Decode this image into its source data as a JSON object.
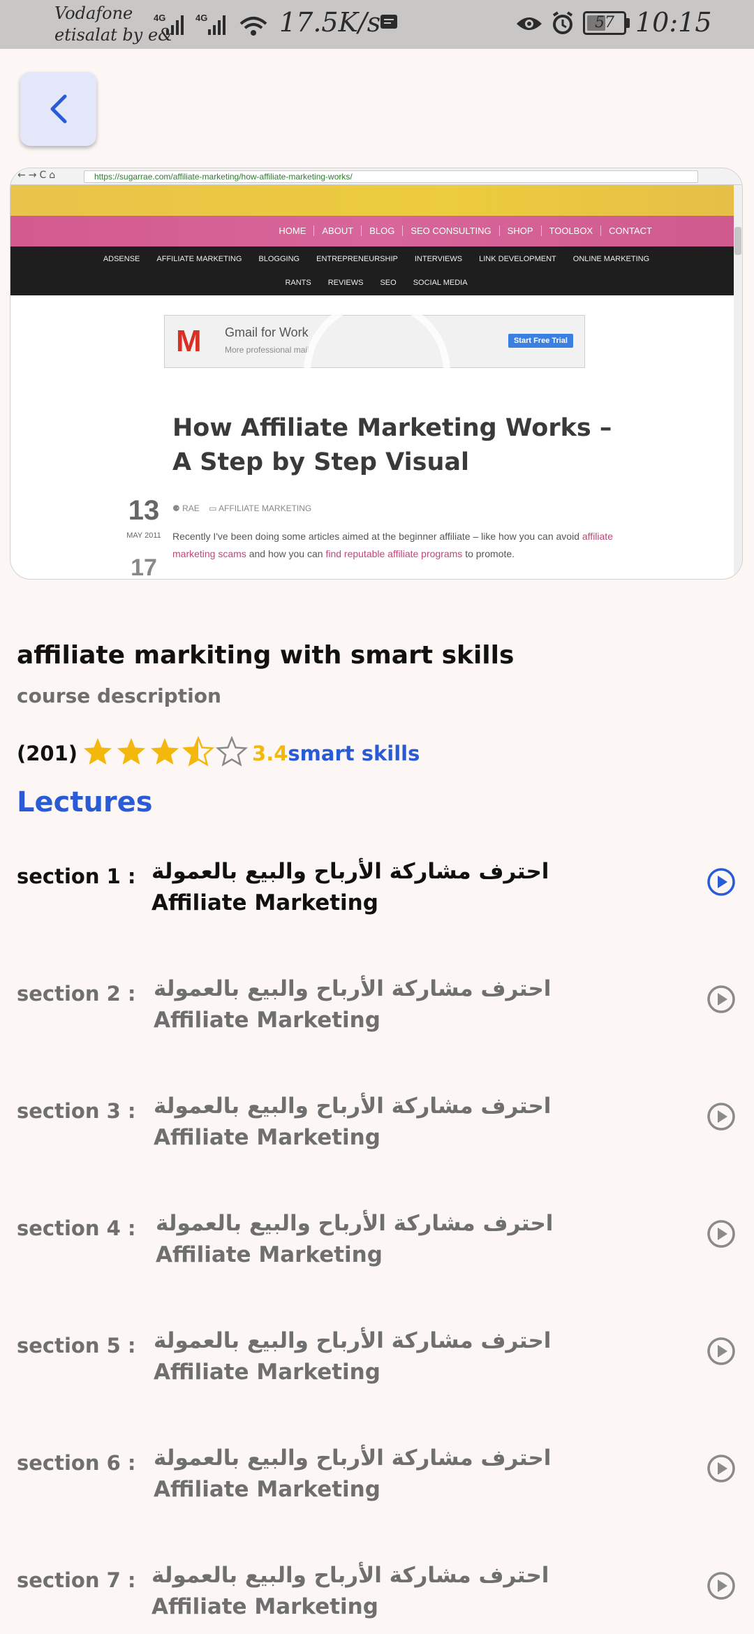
{
  "status_bar": {
    "carrier_line1": "Vodafone",
    "carrier_line2": "etisalat by e&",
    "net1": "4G",
    "net2": "4G",
    "speed": "17.5K/s",
    "battery": "57",
    "battery_level": 57,
    "time": "10:15"
  },
  "video": {
    "url": "https://sugarrae.com/affiliate-marketing/how-affiliate-marketing-works/",
    "top_menu": [
      "HOME",
      "ABOUT",
      "BLOG",
      "SEO CONSULTING",
      "SHOP",
      "TOOLBOX",
      "CONTACT"
    ],
    "categories_row1": [
      "ADSENSE",
      "AFFILIATE MARKETING",
      "BLOGGING",
      "ENTREPRENEURSHIP",
      "INTERVIEWS",
      "LINK DEVELOPMENT",
      "ONLINE MARKETING"
    ],
    "categories_row2": [
      "RANTS",
      "REVIEWS",
      "SEO",
      "SOCIAL MEDIA"
    ],
    "ad_title": "Gmail for Work",
    "ad_sub": "More professional   mail",
    "ad_button": "Start Free Trial",
    "article_title": "How Affiliate Marketing Works – A Step by Step Visual",
    "date_day": "13",
    "date_month": "MAY 2011",
    "date_next": "17",
    "meta_author": "RAE",
    "meta_category": "AFFILIATE MARKETING",
    "excerpt_1": "Recently I've been doing some articles aimed at the beginner affiliate – like how you can avoid ",
    "excerpt_link1": "affiliate marketing scams",
    "excerpt_2": " and how you can ",
    "excerpt_link2": "find reputable affiliate programs",
    "excerpt_3": " to promote."
  },
  "course": {
    "title": "affiliate markiting with smart skills",
    "description_label": "course description",
    "rating_count": "(201)",
    "rating": 3.4,
    "rating_text": "3.4",
    "author": "smart skills",
    "lectures_heading": "Lectures"
  },
  "lectures": [
    {
      "section": "section 1 :",
      "title": "احترف مشاركة الأرباح والبيع بالعمولة Affiliate Marketing",
      "active": true
    },
    {
      "section": "section 2 :",
      "title": "احترف مشاركة الأرباح والبيع بالعمولة Affiliate Marketing",
      "active": false
    },
    {
      "section": "section 3 :",
      "title": "احترف مشاركة الأرباح والبيع بالعمولة Affiliate Marketing",
      "active": false
    },
    {
      "section": "section 4 :",
      "title": "احترف مشاركة الأرباح والبيع بالعمولة Affiliate Marketing",
      "active": false
    },
    {
      "section": "section 5 :",
      "title": "احترف مشاركة الأرباح والبيع بالعمولة Affiliate Marketing",
      "active": false
    },
    {
      "section": "section 6 :",
      "title": "احترف مشاركة الأرباح والبيع بالعمولة Affiliate Marketing",
      "active": false
    },
    {
      "section": "section 7 :",
      "title": "احترف مشاركة الأرباح والبيع بالعمولة Affiliate Marketing",
      "active": false
    }
  ],
  "colors": {
    "accent": "#2a5bd7",
    "star": "#f4b80c",
    "muted": "#6f6f6f",
    "background": "#fcf7f4"
  },
  "icons": {
    "back": "chevron-left-icon",
    "play": "play-circle-icon",
    "star": "star-icon"
  }
}
